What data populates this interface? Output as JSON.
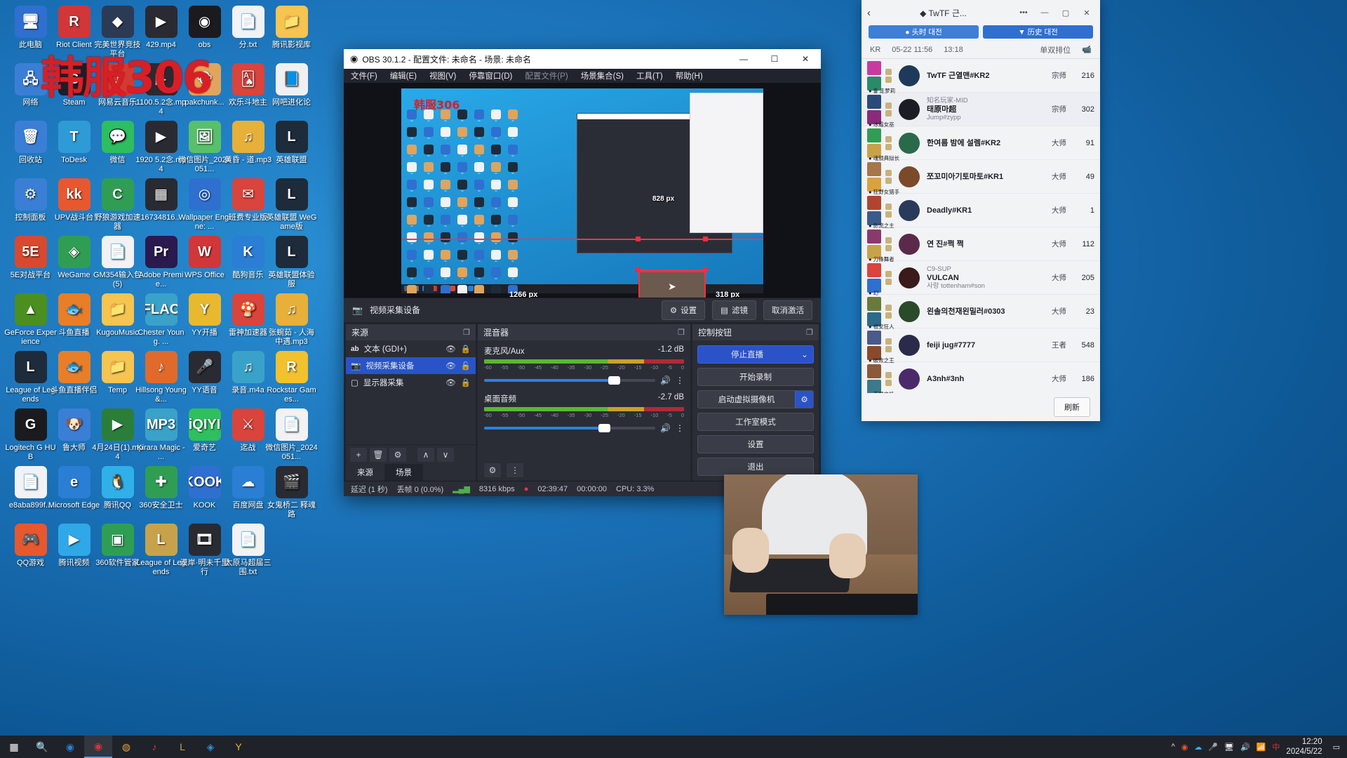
{
  "desktop": {
    "watermark": "韩服306",
    "icons": [
      {
        "label": "此电脑",
        "glyph": "🖥",
        "color": "#2f6fd0"
      },
      {
        "label": "Riot Client",
        "glyph": "R",
        "color": "#d13639"
      },
      {
        "label": "完美世界竞技平台",
        "glyph": "◆",
        "color": "#2b3b55"
      },
      {
        "label": "429.mp4",
        "glyph": "▶",
        "color": "#2a2a33"
      },
      {
        "label": "obs",
        "glyph": "◉",
        "color": "#1b1b1f"
      },
      {
        "label": "分.txt",
        "glyph": "📄",
        "color": "#f2f2f4"
      },
      {
        "label": "腾讯影视库",
        "glyph": "📁",
        "color": "#f5c451"
      },
      {
        "label": "网络",
        "glyph": "🖧",
        "color": "#3a7fd5"
      },
      {
        "label": "Steam",
        "glyph": "S",
        "color": "#16202d"
      },
      {
        "label": "网易云音乐",
        "glyph": "♪",
        "color": "#d33a31"
      },
      {
        "label": "1100.5.2念.mp4",
        "glyph": "▶",
        "color": "#2a2a33"
      },
      {
        "label": "pakchunk...",
        "glyph": "🐵",
        "color": "#e0a45c"
      },
      {
        "label": "欢乐斗地主",
        "glyph": "🂡",
        "color": "#d9443c"
      },
      {
        "label": "网吧进化论",
        "glyph": "📘",
        "color": "#f0f0f2"
      },
      {
        "label": "回收站",
        "glyph": "🗑",
        "color": "#3a7fd5"
      },
      {
        "label": "ToDesk",
        "glyph": "T",
        "color": "#2e9bd6"
      },
      {
        "label": "微信",
        "glyph": "💬",
        "color": "#2dbe60"
      },
      {
        "label": "1920 5.2念.mp4",
        "glyph": "▶",
        "color": "#2a2a33"
      },
      {
        "label": "微信图片_2024051...",
        "glyph": "🖼",
        "color": "#58c06a"
      },
      {
        "label": "黄昏 - 道.mp3",
        "glyph": "♫",
        "color": "#e6b03a"
      },
      {
        "label": "英雄联盟",
        "glyph": "L",
        "color": "#1d2b3a"
      },
      {
        "label": "控制面板",
        "glyph": "⚙",
        "color": "#3a7fd5"
      },
      {
        "label": "UPV战斗台",
        "glyph": "kk",
        "color": "#e8582f"
      },
      {
        "label": "野狼游戏加速器",
        "glyph": "C",
        "color": "#2f9e54"
      },
      {
        "label": "16734816...",
        "glyph": "▦",
        "color": "#2a2a33"
      },
      {
        "label": "Wallpaper Engine: ...",
        "glyph": "◎",
        "color": "#2f6fd0"
      },
      {
        "label": "班费专业版",
        "glyph": "✉",
        "color": "#d9443c"
      },
      {
        "label": "英雄联盟 WeGame版",
        "glyph": "L",
        "color": "#1d2b3a"
      },
      {
        "label": "5E对战平台",
        "glyph": "5E",
        "color": "#d8492f"
      },
      {
        "label": "WeGame",
        "glyph": "◈",
        "color": "#2f9e54"
      },
      {
        "label": "GM354输入包 (5)",
        "glyph": "📄",
        "color": "#f2f2f4"
      },
      {
        "label": "Adobe Premie...",
        "glyph": "Pr",
        "color": "#2b1a4d"
      },
      {
        "label": "WPS Office",
        "glyph": "W",
        "color": "#d13639"
      },
      {
        "label": "酷狗音乐",
        "glyph": "K",
        "color": "#2a7ed4"
      },
      {
        "label": "英雄联盟体验服",
        "glyph": "L",
        "color": "#1d2b3a"
      },
      {
        "label": "GeForce Experience",
        "glyph": "▲",
        "color": "#4a8f1f"
      },
      {
        "label": "斗鱼直播",
        "glyph": "🐟",
        "color": "#e87e28"
      },
      {
        "label": "KugouMusic",
        "glyph": "📁",
        "color": "#f5c451"
      },
      {
        "label": "Chester Young. ...",
        "glyph": "FLAC",
        "color": "#3aa2c9"
      },
      {
        "label": "YY开播",
        "glyph": "Y",
        "color": "#e8b92f"
      },
      {
        "label": "雷神加速器",
        "glyph": "🍄",
        "color": "#d9443c"
      },
      {
        "label": "张蜿茹 - 人海中遇.mp3",
        "glyph": "♫",
        "color": "#e6b03a"
      },
      {
        "label": "League of Legends",
        "glyph": "L",
        "color": "#1d2b3a"
      },
      {
        "label": "斗鱼直播伴侣",
        "glyph": "🐟",
        "color": "#e87e28"
      },
      {
        "label": "Temp",
        "glyph": "📁",
        "color": "#f5c451"
      },
      {
        "label": "Hillsong Young &...",
        "glyph": "♪",
        "color": "#e06a2b"
      },
      {
        "label": "YY语音",
        "glyph": "🎤",
        "color": "#2a2a33"
      },
      {
        "label": "录音.m4a",
        "glyph": "♫",
        "color": "#3aa2c9"
      },
      {
        "label": "Rockstar Games...",
        "glyph": "R",
        "color": "#f2c12e"
      },
      {
        "label": "Logitech G HUB",
        "glyph": "G",
        "color": "#1b1b1f"
      },
      {
        "label": "鲁大师",
        "glyph": "🐶",
        "color": "#3a7fd5"
      },
      {
        "label": "4月24日(1).mp4",
        "glyph": "▶",
        "color": "#2a7e3a"
      },
      {
        "label": "Kirara Magic - ...",
        "glyph": "MP3",
        "color": "#3aa2c9"
      },
      {
        "label": "爱奇艺",
        "glyph": "iQIYI",
        "color": "#2fbf5f"
      },
      {
        "label": "迄战",
        "glyph": "⚔",
        "color": "#d9443c"
      },
      {
        "label": "微信图片_2024051...",
        "glyph": "📄",
        "color": "#f2f2f4"
      },
      {
        "label": "e8aba899f...",
        "glyph": "📄",
        "color": "#f2f2f4"
      },
      {
        "label": "Microsoft Edge",
        "glyph": "e",
        "color": "#2a7ed4"
      },
      {
        "label": "腾讯QQ",
        "glyph": "🐧",
        "color": "#2fb0e8"
      },
      {
        "label": "360安全卫士",
        "glyph": "✚",
        "color": "#2f9e54"
      },
      {
        "label": "KOOK",
        "glyph": "KOOK",
        "color": "#2f6fd0"
      },
      {
        "label": "百度网盘",
        "glyph": "☁",
        "color": "#2a7ed4"
      },
      {
        "label": "女鬼桥二 释魂路",
        "glyph": "🎬",
        "color": "#2a2a33"
      },
      {
        "label": "QQ游戏",
        "glyph": "🎮",
        "color": "#e8582f"
      },
      {
        "label": "腾讯视频",
        "glyph": "▶",
        "color": "#2fa8e8"
      },
      {
        "label": "360软件管家",
        "glyph": "▣",
        "color": "#2f9e54"
      },
      {
        "label": "League of Legends",
        "glyph": "L",
        "color": "#c8a24a"
      },
      {
        "label": "漠岸·明未千里行",
        "glyph": "🎞",
        "color": "#2a2a33"
      },
      {
        "label": "太原马超届三围.txt",
        "glyph": "📄",
        "color": "#f2f2f4"
      }
    ]
  },
  "taskbar": {
    "icons": [
      "start-icon",
      "search-icon",
      "edge-icon",
      "obs-icon",
      "chrome-icon",
      "netease-icon",
      "lol-icon",
      "wegame-icon",
      "yy-icon"
    ],
    "tray": [
      "^",
      "chat-icon",
      "cloud-icon",
      "mic-icon",
      "monitor-icon",
      "volume-icon",
      "network-icon",
      "ime-icon",
      "notify-icon"
    ],
    "clock_time": "12:20",
    "clock_date": "2024/5/22"
  },
  "obs": {
    "title": "OBS 30.1.2 - 配置文件: 未命名 - 场景: 未命名",
    "window_buttons": {
      "minimize": "—",
      "maximize": "☐",
      "close": "✕"
    },
    "menu": [
      {
        "label": "文件(F)",
        "dim": false
      },
      {
        "label": "编辑(E)",
        "dim": false
      },
      {
        "label": "视图(V)",
        "dim": false
      },
      {
        "label": "停靠窗口(D)",
        "dim": false
      },
      {
        "label": "配置文件(P)",
        "dim": true
      },
      {
        "label": "场景集合(S)",
        "dim": false
      },
      {
        "label": "工具(T)",
        "dim": false
      },
      {
        "label": "帮助(H)",
        "dim": false
      }
    ],
    "preview": {
      "selected_source_label": "视频采集设备",
      "width_label": "1266 px",
      "height_label": "318 px",
      "inner_label": "828 px",
      "mini_watermark": "韩服306"
    },
    "source_toolbar": {
      "name": "视频采集设备",
      "settings": "设置",
      "filters": "滤镜",
      "deactivate": "取消激活"
    },
    "sources_panel": {
      "header": "来源",
      "items": [
        {
          "name": "文本 (GDI+)",
          "icon": "ab",
          "selected": false,
          "locked": true
        },
        {
          "name": "视频采集设备",
          "icon": "camera",
          "selected": true,
          "locked": false
        },
        {
          "name": "显示器采集",
          "icon": "monitor",
          "selected": false,
          "locked": true
        }
      ],
      "tools": [
        "+",
        "🗑",
        "⚙",
        "∧",
        "∨"
      ],
      "tabs": [
        {
          "label": "来源",
          "active": true
        },
        {
          "label": "场景",
          "active": false
        }
      ]
    },
    "mixer_panel": {
      "header": "混音器",
      "channels": [
        {
          "name": "麦克风/Aux",
          "db": "-1.2 dB",
          "volume_pct": 76,
          "ticks": [
            "-60",
            "-55",
            "-50",
            "-45",
            "-40",
            "-35",
            "-30",
            "-25",
            "-20",
            "-15",
            "-10",
            "-5",
            "0"
          ]
        },
        {
          "name": "桌面音频",
          "db": "-2.7 dB",
          "volume_pct": 70,
          "ticks": [
            "-60",
            "-55",
            "-50",
            "-45",
            "-40",
            "-35",
            "-30",
            "-25",
            "-20",
            "-15",
            "-10",
            "-5",
            "0"
          ]
        }
      ]
    },
    "controls_panel": {
      "header": "控制按钮",
      "buttons": [
        {
          "label": "停止直播",
          "primary": true,
          "chevron": true
        },
        {
          "label": "开始录制",
          "primary": false
        },
        {
          "label": "启动虚拟摄像机",
          "primary": false,
          "gear": true
        },
        {
          "label": "工作室模式",
          "primary": false
        },
        {
          "label": "设置",
          "primary": false
        },
        {
          "label": "退出",
          "primary": false
        }
      ]
    },
    "statusbar": {
      "latency": "延迟 (1 秒)",
      "dropped": "丢帧 0 (0.0%)",
      "bitrate": "8316 kbps",
      "stream_time": "02:39:47",
      "rec_time": "00:00:00",
      "cpu": "CPU: 3.3%"
    }
  },
  "game_panel": {
    "title": "◆ TwTF 근...",
    "back_icon": "chevron-left-icon",
    "window_buttons": {
      "dots": "•••",
      "minimize": "—",
      "maximize": "▢",
      "close": "✕"
    },
    "tabs": [
      {
        "label": "● 头时 대전",
        "style": "blue"
      },
      {
        "label": "▼ 历史 대전",
        "style": "blue2"
      }
    ],
    "subheader": {
      "region": "KR",
      "date": "05-22 11:56",
      "duration": "13:18",
      "queue": "单双排位",
      "camera_icon": "camera-icon"
    },
    "players": [
      {
        "name": "TwTF 근열맨#KR2",
        "sub": "",
        "tier": "宗师",
        "lp": "216",
        "champ": "홀 走萝莉",
        "c1": "#c93aa0",
        "c2": "#2a8a6a",
        "face": "#1e3a5a"
      },
      {
        "name": "태原마超",
        "sub": "Jump#zypp",
        "role": "知名玩家-MID",
        "tier": "宗师",
        "lp": "302",
        "champ": "冰霜女巫",
        "c1": "#2b4a7a",
        "c2": "#8a2b7a",
        "face": "#1b1d24",
        "highlight": true
      },
      {
        "name": "한여름 밤에 설렘#KR2",
        "sub": "",
        "tier": "大师",
        "lp": "91",
        "champ": "魂锁典狱长",
        "c1": "#2f9e54",
        "c2": "#c8a24a",
        "face": "#2a6a4a"
      },
      {
        "name": "쪼꼬미아기토마토#KR1",
        "sub": "",
        "tier": "大师",
        "lp": "49",
        "champ": "狂野女猎手",
        "c1": "#a6764a",
        "c2": "#d9a23c",
        "face": "#7a4a2a"
      },
      {
        "name": "Deadly#KR1",
        "sub": "",
        "tier": "大师",
        "lp": "1",
        "champ": "影流之主",
        "c1": "#b0452f",
        "c2": "#3a5a8a",
        "face": "#2a3a5a"
      },
      {
        "name": "연 진#쩍 쩍",
        "sub": "",
        "tier": "大师",
        "lp": "112",
        "champ": "刀锋舞者",
        "c1": "#8a3a6a",
        "c2": "#c8a24a",
        "face": "#5a2a4a"
      },
      {
        "name": "VULCAN",
        "sub": "사랑 tottenham#son",
        "role": "C9-SUP",
        "tier": "大师",
        "lp": "205",
        "champ": "幻",
        ":c1": "",
        "c1": "#d9443c",
        "c2": "#2f6fd0",
        "face": "#3a1a1a"
      },
      {
        "name": "왼솔의천재왼밀러#0303",
        "sub": "",
        "tier": "大师",
        "lp": "23",
        "champ": "祖安狂人",
        "c1": "#6a7a3a",
        "c2": "#2a6a8a",
        "face": "#2a4a2a"
      },
      {
        "name": "feiji jug#7777",
        "sub": "",
        "tier": "王者",
        "lp": "548",
        "champ": "破败之王",
        "c1": "#4a5a8a",
        "c2": "#8a4a2a",
        "face": "#2a2a4a"
      },
      {
        "name": "A3nh#3nh",
        "sub": "",
        "tier": "大师",
        "lp": "186",
        "champ": "不屈之枪",
        "c1": "#8a5a3a",
        "c2": "#3a7a8a",
        "face": "#4a2a6a"
      }
    ],
    "refresh_label": "刷新"
  }
}
